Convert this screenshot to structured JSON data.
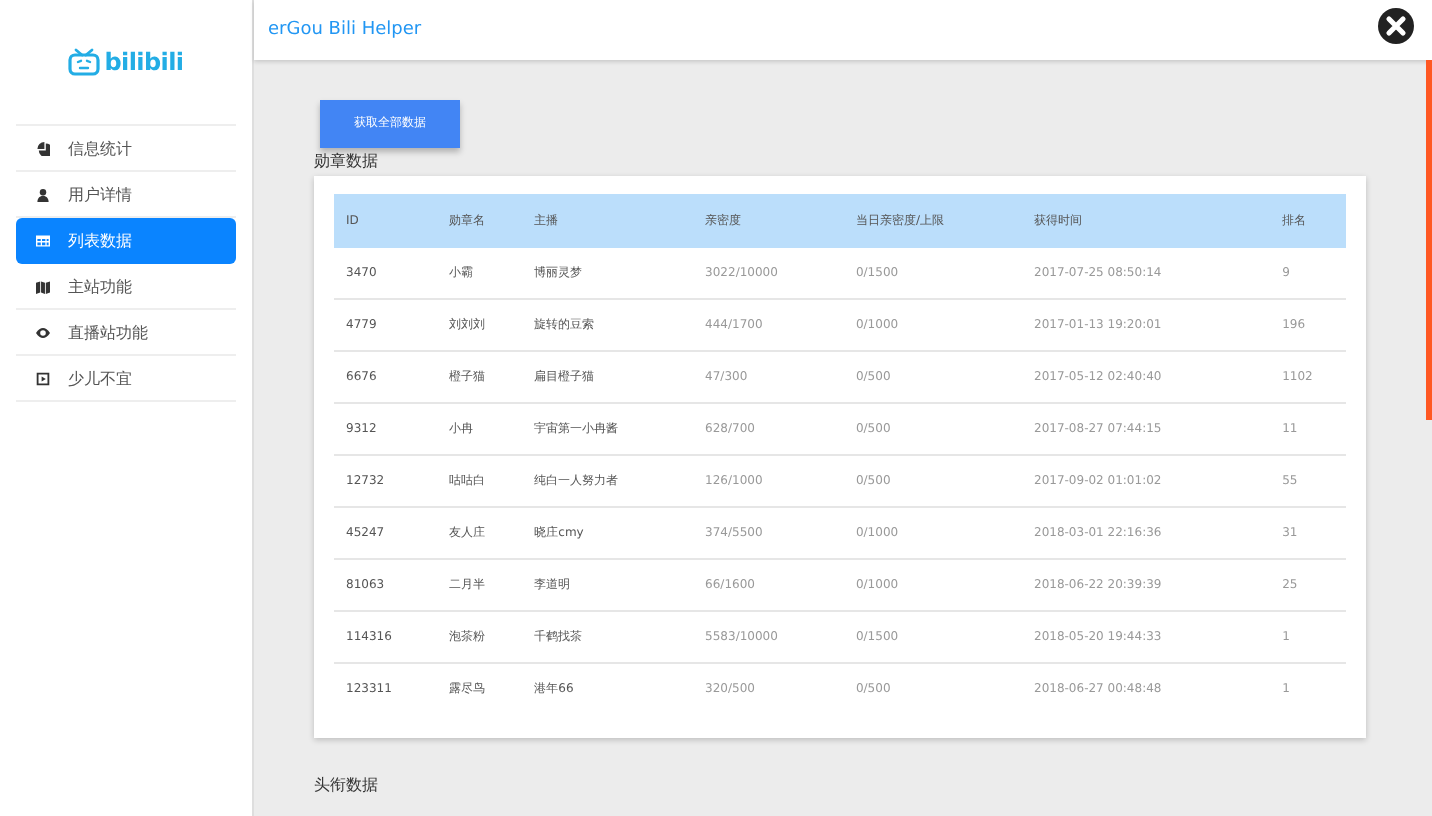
{
  "sidebar": {
    "logo": "bilibili",
    "items": [
      {
        "label": "信息统计",
        "kind": "pie",
        "selected": false
      },
      {
        "label": "用户详情",
        "kind": "user",
        "selected": false
      },
      {
        "label": "列表数据",
        "kind": "table",
        "selected": true
      },
      {
        "label": "主站功能",
        "kind": "map",
        "selected": false
      },
      {
        "label": "直播站功能",
        "kind": "eye",
        "selected": false
      },
      {
        "label": "少儿不宜",
        "kind": "play",
        "selected": false
      }
    ]
  },
  "header": {
    "title": "erGou Bili Helper"
  },
  "fetch_button": "获取全部数据",
  "medal_section": {
    "title": "勋章数据",
    "table": {
      "columns": [
        "ID",
        "勋章名",
        "主播",
        "亲密度",
        "当日亲密度/上限",
        "获得时间",
        "排名"
      ],
      "rows": [
        [
          "3470",
          "小霸",
          "博丽灵梦",
          "3022/10000",
          "0/1500",
          "2017-07-25 08:50:14",
          "9"
        ],
        [
          "4779",
          "刘刘刘",
          "旋转的豆索",
          "444/1700",
          "0/1000",
          "2017-01-13 19:20:01",
          "196"
        ],
        [
          "6676",
          "橙子猫",
          "扁目橙子猫",
          "47/300",
          "0/500",
          "2017-05-12 02:40:40",
          "1102"
        ],
        [
          "9312",
          "小冉",
          "宇宙第一小冉酱",
          "628/700",
          "0/500",
          "2017-08-27 07:44:15",
          "11"
        ],
        [
          "12732",
          "咕咕白",
          "纯白一人努力者",
          "126/1000",
          "0/500",
          "2017-09-02 01:01:02",
          "55"
        ],
        [
          "45247",
          "友人庄",
          "晓庄cmy",
          "374/5500",
          "0/1000",
          "2018-03-01 22:16:36",
          "31"
        ],
        [
          "81063",
          "二月半",
          "李道明",
          "66/1600",
          "0/1000",
          "2018-06-22 20:39:39",
          "25"
        ],
        [
          "114316",
          "泡茶粉",
          "千鹤找茶",
          "5583/10000",
          "0/1500",
          "2018-05-20 19:44:33",
          "1"
        ],
        [
          "123311",
          "露尽鸟",
          "港年66",
          "320/500",
          "0/500",
          "2018-06-27 00:48:48",
          "1"
        ]
      ]
    }
  },
  "title_section": {
    "title": "头衔数据"
  }
}
